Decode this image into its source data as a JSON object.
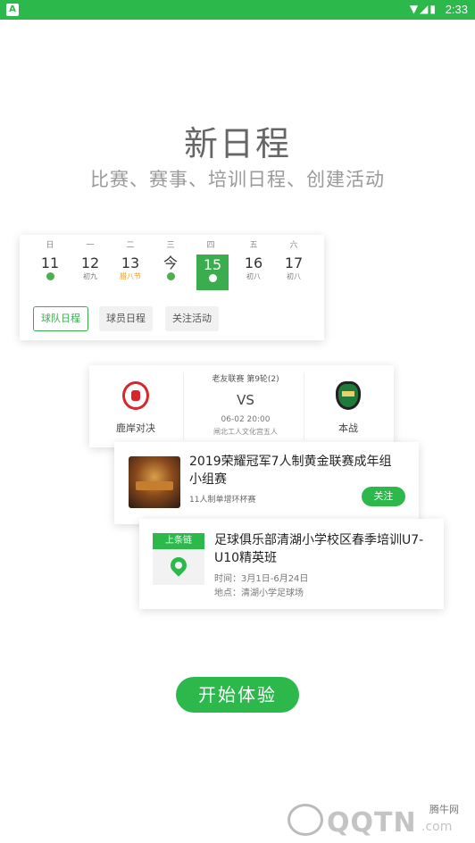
{
  "status_bar": {
    "time": "2:33",
    "app_badge": "A",
    "icons": [
      "wifi-icon",
      "signal-icon",
      "battery-icon"
    ]
  },
  "headline": "新日程",
  "subline": "比赛、赛事、培训日程、创建活动",
  "calendar": {
    "days": [
      {
        "weekday": "日",
        "date": "11",
        "sub": "",
        "dot": true
      },
      {
        "weekday": "一",
        "date": "12",
        "sub": "初九",
        "dot": false
      },
      {
        "weekday": "二",
        "date": "13",
        "sub": "腊八节",
        "dot": false
      },
      {
        "weekday": "三",
        "date": "今",
        "sub": "",
        "dot": true
      },
      {
        "weekday": "四",
        "date": "15",
        "sub": "",
        "dot": true,
        "selected": true
      },
      {
        "weekday": "五",
        "date": "16",
        "sub": "初八",
        "dot": false
      },
      {
        "weekday": "六",
        "date": "17",
        "sub": "初八",
        "dot": false
      }
    ],
    "tabs": [
      "球队日程",
      "球员日程",
      "关注活动"
    ],
    "active_tab": 0
  },
  "match": {
    "league": "老友联赛 第9轮(2)",
    "vs": "VS",
    "home_team": "鹿岸对决",
    "away_team": "本战",
    "time": "06-02 20:00",
    "venue": "闸北工人文化宫五人"
  },
  "event": {
    "title": "2019荣耀冠军7人制黄金联赛成年组 小组赛",
    "meta": "11人制单增环杯赛",
    "follow_label": "关注"
  },
  "training": {
    "badge": "上条链",
    "title": "足球俱乐部清湖小学校区春季培训U7-U10精英班",
    "time": "时间：3月1日-6月24日",
    "place": "地点：清湖小学足球场"
  },
  "cta_label": "开始体验",
  "watermark": {
    "text": "腾牛网",
    "brand": "QQTN",
    "suffix": ".com"
  },
  "colors": {
    "accent": "#2db84c",
    "heading": "#666666",
    "subtext": "#9a9a9a"
  }
}
